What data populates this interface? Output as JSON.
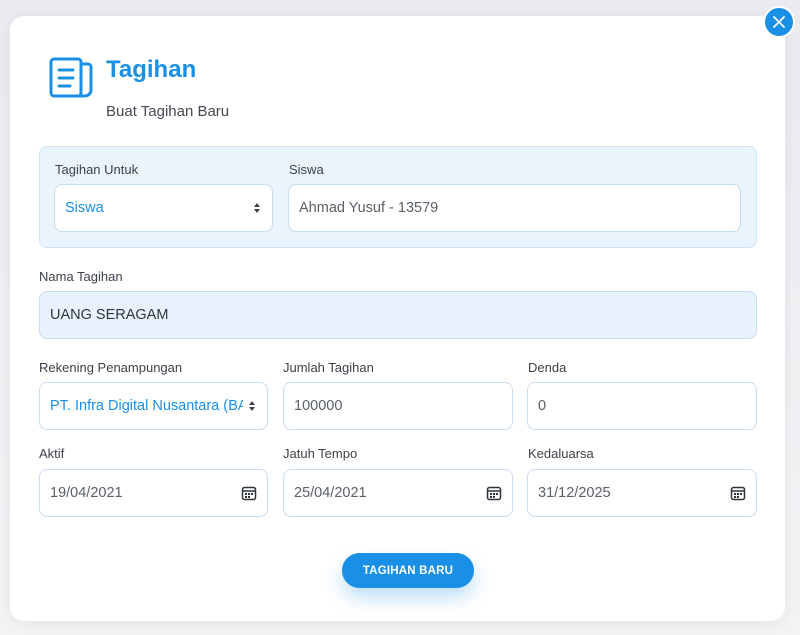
{
  "header": {
    "icon": "document-list-icon",
    "title": "Tagihan",
    "subtitle": "Buat Tagihan Baru"
  },
  "close_button": {
    "icon": "close-icon"
  },
  "form": {
    "tagihan_untuk": {
      "label": "Tagihan Untuk",
      "value": "Siswa"
    },
    "siswa": {
      "label": "Siswa",
      "value": "Ahmad Yusuf - 13579"
    },
    "nama_tagihan": {
      "label": "Nama Tagihan",
      "value": "UANG SERAGAM"
    },
    "rekening_penampungan": {
      "label": "Rekening Penampungan",
      "value": "PT. Infra Digital Nusantara (BA"
    },
    "jumlah_tagihan": {
      "label": "Jumlah Tagihan",
      "value": "100000"
    },
    "denda": {
      "label": "Denda",
      "value": "0"
    },
    "aktif": {
      "label": "Aktif",
      "value": "19/04/2021"
    },
    "jatuh_tempo": {
      "label": "Jatuh Tempo",
      "value": "25/04/2021"
    },
    "kedaluarsa": {
      "label": "Kedaluarsa",
      "value": "31/12/2025"
    }
  },
  "submit": {
    "label": "TAGIHAN BARU"
  },
  "colors": {
    "accent": "#1a8fe6",
    "panel_bg": "#eaf4fd",
    "field_border": "#c9dcee",
    "filled_bg": "#e8f1fc"
  }
}
